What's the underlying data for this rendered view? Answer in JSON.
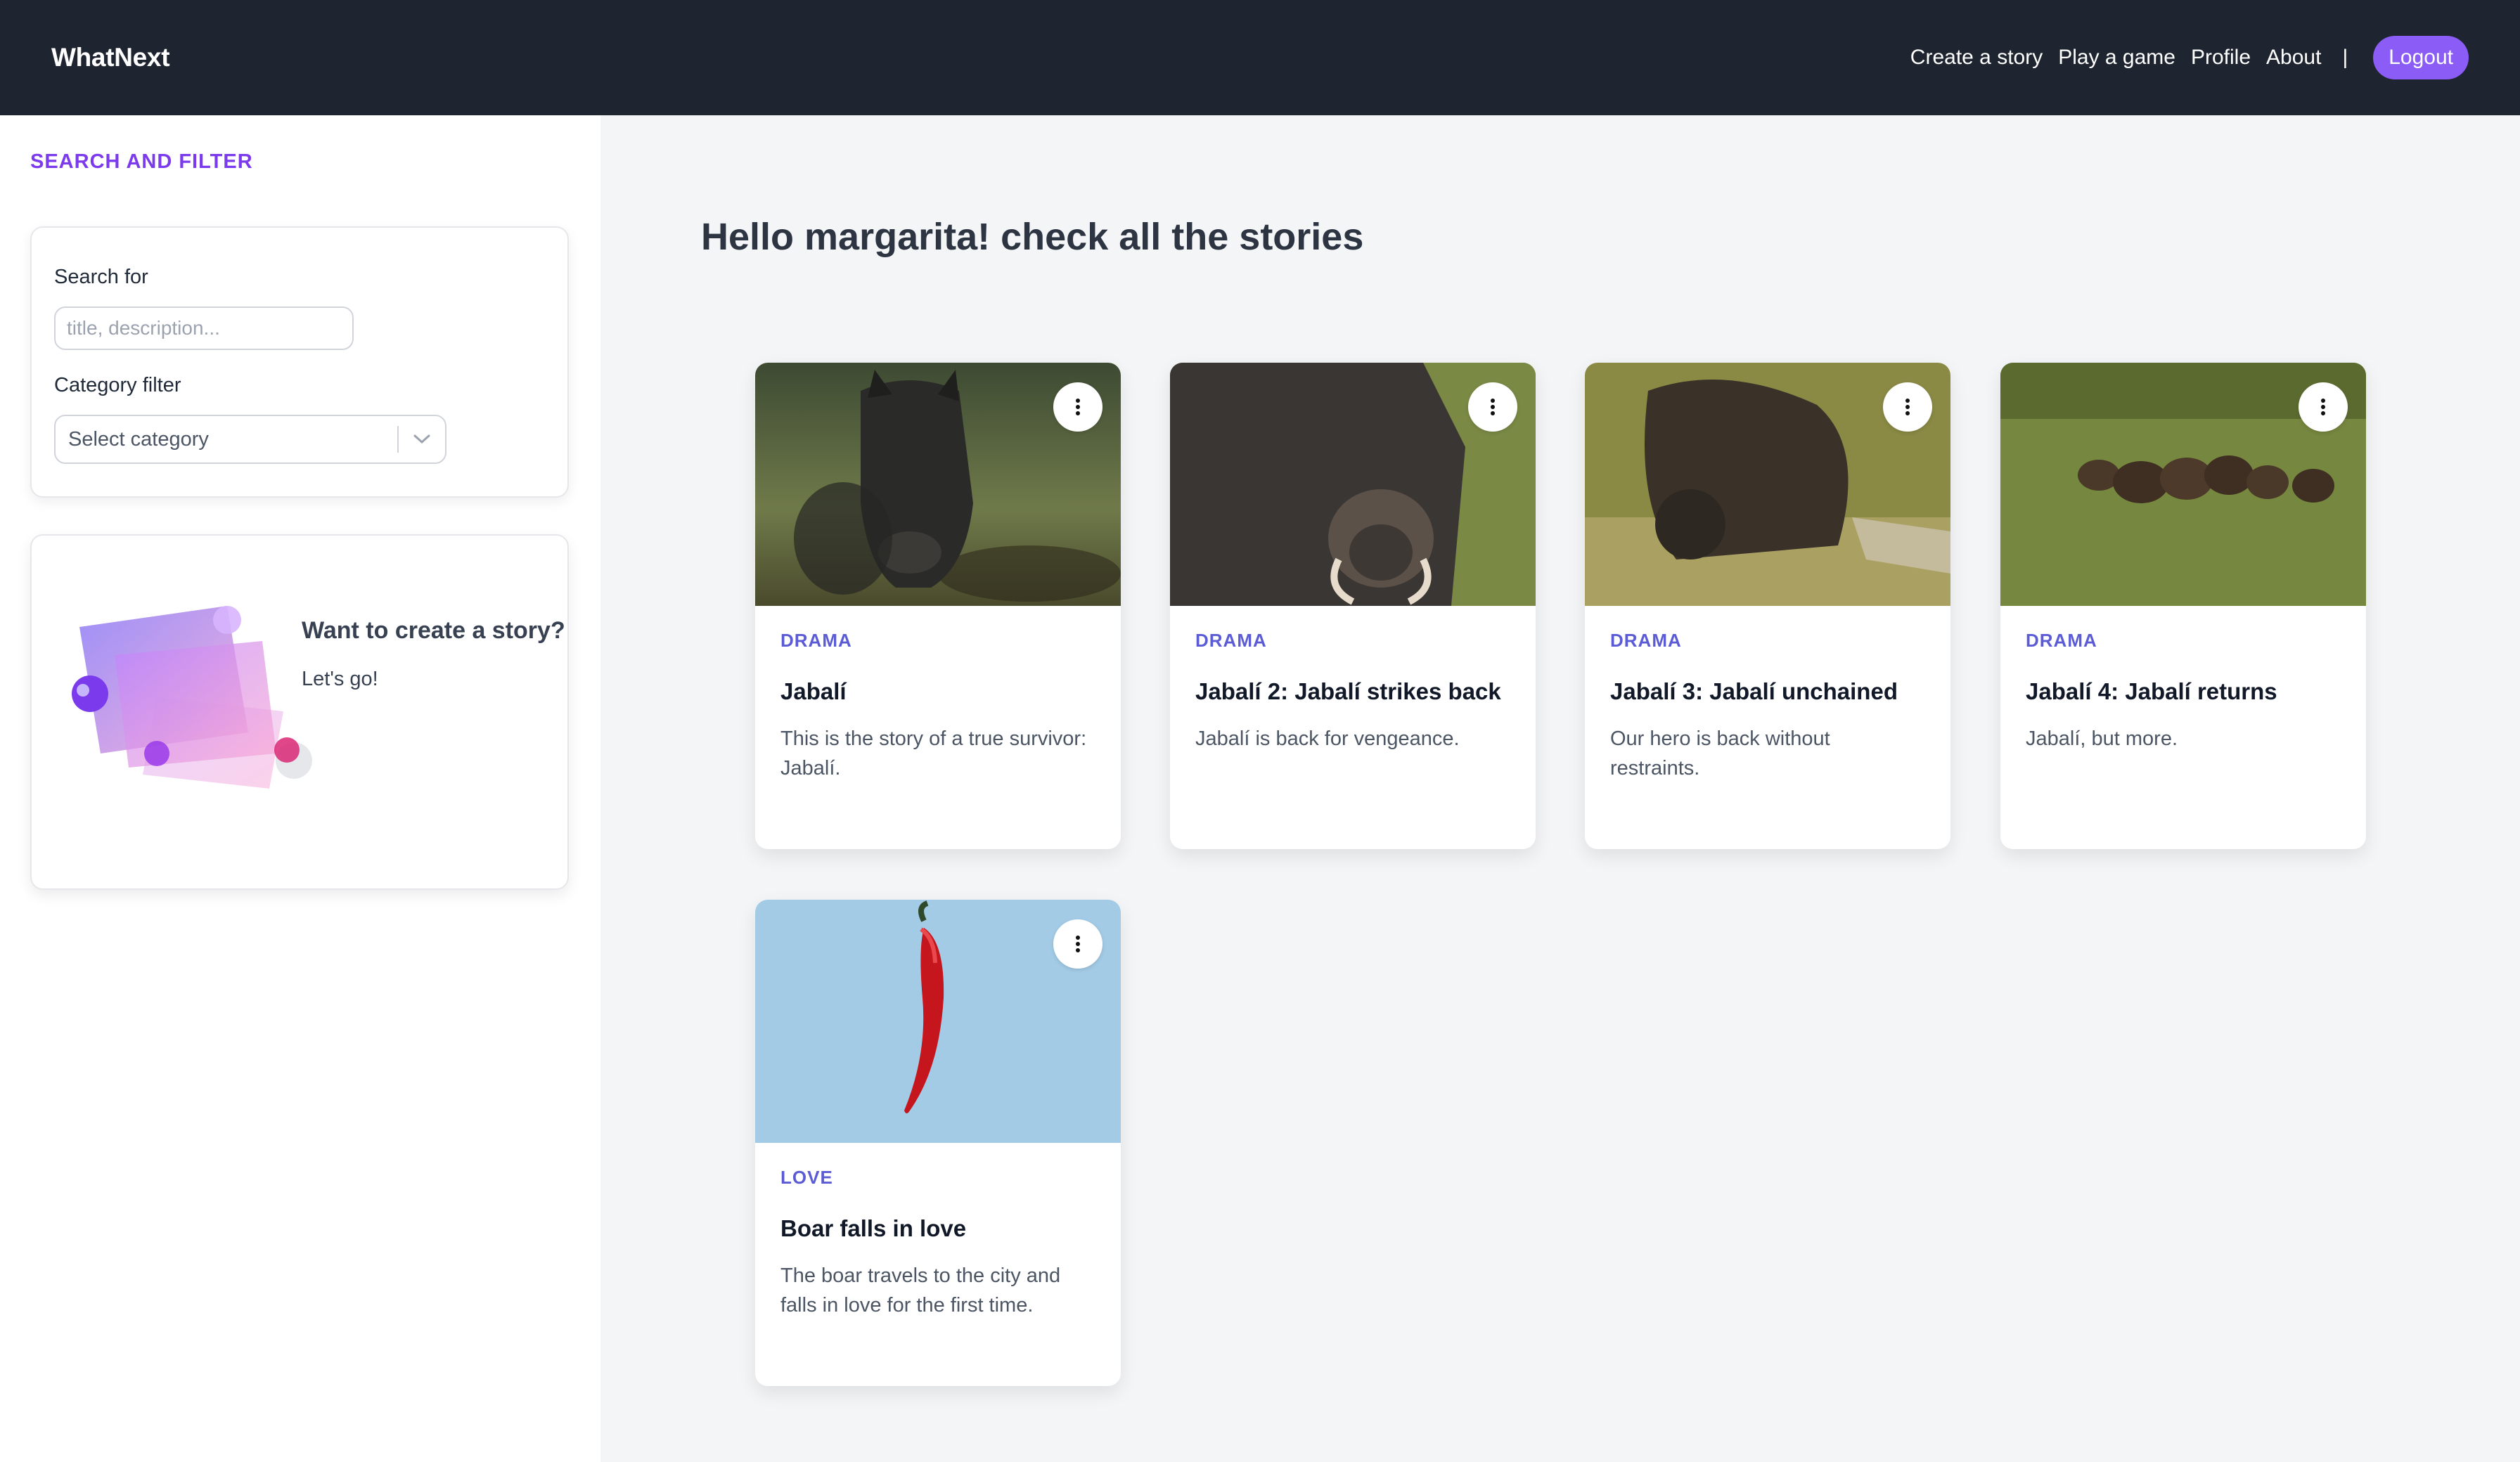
{
  "nav": {
    "brand": "WhatNext",
    "links": [
      "Create a story",
      "Play a game",
      "Profile",
      "About"
    ],
    "separator": "|",
    "logout": "Logout"
  },
  "sidebar": {
    "heading": "SEARCH AND FILTER",
    "search_label": "Search for",
    "search_placeholder": "title, description...",
    "search_value": "",
    "category_label": "Category filter",
    "category_selected": "Select category",
    "create_title": "Want to create a story?",
    "create_cta": "Let's go!"
  },
  "main": {
    "greeting": "Hello margarita! check all the stories",
    "stories": [
      {
        "category": "DRAMA",
        "title": "Jabalí",
        "description": "This is the story of a true survivor: Jabalí.",
        "image": "wild-boar-photo"
      },
      {
        "category": "DRAMA",
        "title": "Jabalí 2: Jabalí strikes back",
        "description": "Jabalí is back for vengeance.",
        "image": "boar-closeup-photo"
      },
      {
        "category": "DRAMA",
        "title": "Jabalí 3: Jabalí unchained",
        "description": "Our hero is back without restraints.",
        "image": "boar-grass-photo"
      },
      {
        "category": "DRAMA",
        "title": "Jabalí 4: Jabalí returns",
        "description": "Jabalí, but more.",
        "image": "boar-herd-photo"
      },
      {
        "category": "LOVE",
        "title": "Boar falls in love",
        "description": "The boar travels to the city and falls in love for the first time.",
        "image": "red-chili-photo"
      }
    ]
  },
  "colors": {
    "nav_bg": "#1f2530",
    "accent": "#8b5cf6",
    "category": "#5b5bd6"
  }
}
